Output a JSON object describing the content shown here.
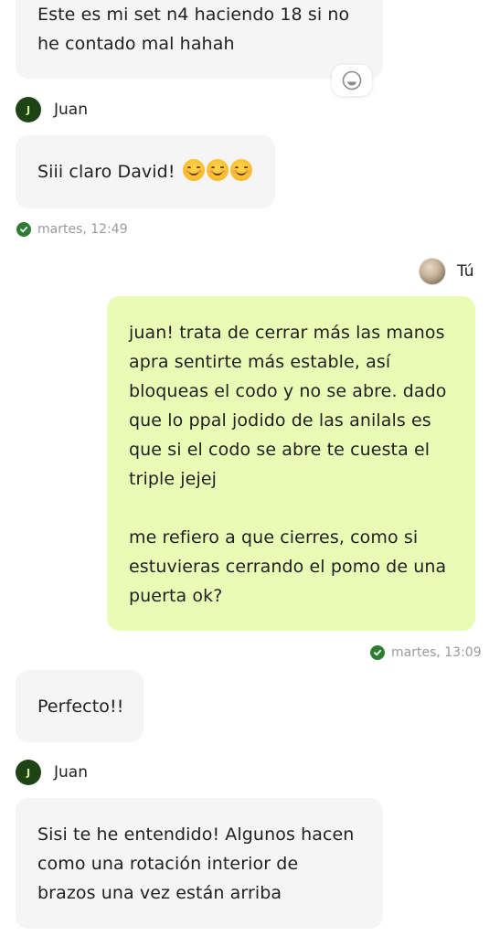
{
  "messages": {
    "m1": {
      "lines": [
        "Este es mi set n4 haciendo 18 si no",
        "he contado mal hahah"
      ]
    },
    "m2": {
      "sender": "Juan",
      "avatar_initial": "J",
      "text": "Siii claro David!",
      "emoji_count": 3
    },
    "m2_time": "martes, 12:49",
    "m3": {
      "sender": "Tú",
      "lines": [
        "juan! trata de cerrar más las manos",
        "apra sentirte más estable, así",
        "bloqueas el codo y no se abre. dado",
        "que lo ppal jodido de las anilals es",
        "que si el codo se abre te cuesta el",
        "triple jejej",
        "",
        "me refiero a que cierres, como si",
        "estuvieras cerrando el pomo de una",
        "puerta ok?"
      ]
    },
    "m3_time": "martes, 13:09",
    "m4": {
      "text": "Perfecto!!"
    },
    "m5": {
      "sender": "Juan",
      "avatar_initial": "J",
      "lines": [
        "Sisi te he entendido! Algunos hacen",
        "como una rotación interior de",
        "brazos una vez están arriba"
      ]
    }
  },
  "icons": {
    "react": "smiley-react-icon",
    "read": "check-circle-icon",
    "emoji": "smiling-face-emoji"
  },
  "colors": {
    "incoming_bubble": "#f5f5f5",
    "outgoing_bubble": "#e8fcb6",
    "avatar_bg": "#1e4416",
    "read_check": "#2e7d32"
  }
}
